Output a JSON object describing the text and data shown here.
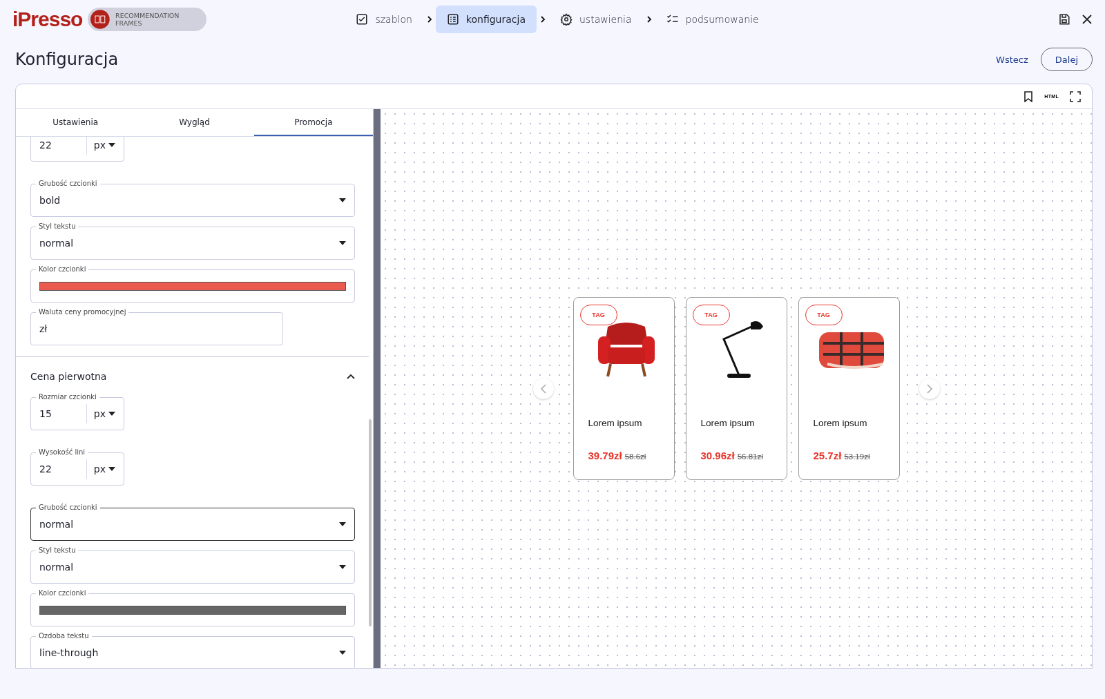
{
  "header": {
    "logo": "iPresso",
    "badge": "RECOMMENDATION FRAMES",
    "steps": [
      {
        "kind": "check",
        "label": "szablon",
        "selected": false
      },
      {
        "kind": "list",
        "label": "konfiguracja",
        "selected": true
      },
      {
        "kind": "gear",
        "label": "ustawienia",
        "selected": false
      },
      {
        "kind": "checklist",
        "label": "podsumowanie",
        "selected": false
      }
    ]
  },
  "title": "Konfiguracja",
  "actions": {
    "back": "Wstecz",
    "next": "Dalej"
  },
  "toolbar": {
    "html": "HTML"
  },
  "tabs": [
    {
      "label": "Ustawienia",
      "selected": false
    },
    {
      "label": "Wygląd",
      "selected": false
    },
    {
      "label": "Promocja",
      "selected": true
    }
  ],
  "sections": [
    {
      "fields": [
        {
          "kind": "unit",
          "value": "22",
          "unit": "px"
        },
        {
          "kind": "select",
          "label": "Grubość czcionki",
          "value": "bold",
          "focused": false
        },
        {
          "kind": "select",
          "label": "Styl tekstu",
          "value": "normal",
          "focused": false
        },
        {
          "kind": "color",
          "label": "Kolor czcionki",
          "color": "#eb5a4e"
        },
        {
          "kind": "text",
          "label": "Waluta ceny promocyjnej",
          "value": "zł"
        }
      ]
    },
    {
      "title": "Cena pierwotna",
      "expanded": true,
      "fields": [
        {
          "kind": "unit",
          "label": "Rozmiar czcionki",
          "value": "15",
          "unit": "px"
        },
        {
          "kind": "unit",
          "label": "Wysokość lini",
          "value": "22",
          "unit": "px"
        },
        {
          "kind": "select",
          "label": "Grubość czcionki",
          "value": "normal",
          "focused": true
        },
        {
          "kind": "select",
          "label": "Styl tekstu",
          "value": "normal",
          "focused": false
        },
        {
          "kind": "color",
          "label": "Kolor czcionki",
          "color": "#666666"
        },
        {
          "kind": "select",
          "label": "Ozdoba tekstu",
          "value": "line-through",
          "focused": false
        }
      ]
    }
  ],
  "products": [
    {
      "kind": "armchair",
      "tag": "TAG",
      "name": "Lorem ipsum",
      "price": "39.79zł",
      "old_price": "58.6zł"
    },
    {
      "kind": "lamp",
      "tag": "TAG",
      "name": "Lorem ipsum",
      "price": "30.96zł",
      "old_price": "56.81zł"
    },
    {
      "kind": "blanket",
      "tag": "TAG",
      "name": "Lorem ipsum",
      "price": "25.7zł",
      "old_price": "53.19zł"
    }
  ]
}
